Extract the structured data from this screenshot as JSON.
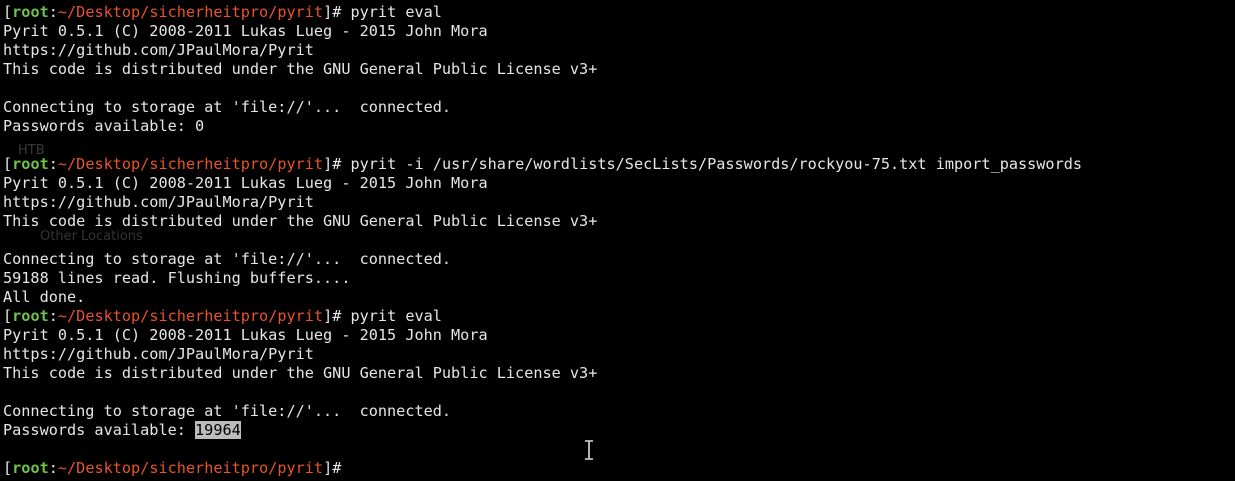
{
  "colors": {
    "background": "#000000",
    "text": "#e6e6e6",
    "user": "#6ec24a",
    "path": "#e8532a",
    "selection": "#bdbdbd"
  },
  "prompt": {
    "open": "[",
    "user": "root",
    "colon": ":",
    "path": "~/Desktop/sicherheitpro/pyrit",
    "close": "]#"
  },
  "ghost": {
    "text1": "HTB",
    "text2": "Other Locations"
  },
  "blocks": [
    {
      "command": " pyrit eval",
      "lines": [
        "Pyrit 0.5.1 (C) 2008-2011 Lukas Lueg - 2015 John Mora",
        "https://github.com/JPaulMora/Pyrit",
        "This code is distributed under the GNU General Public License v3+",
        "",
        "Connecting to storage at 'file://'...  connected.",
        "Passwords available: 0",
        ""
      ]
    },
    {
      "command": " pyrit -i /usr/share/wordlists/SecLists/Passwords/rockyou-75.txt import_passwords",
      "lines": [
        "Pyrit 0.5.1 (C) 2008-2011 Lukas Lueg - 2015 John Mora",
        "https://github.com/JPaulMora/Pyrit",
        "This code is distributed under the GNU General Public License v3+",
        "",
        "Connecting to storage at 'file://'...  connected.",
        "59188 lines read. Flushing buffers....",
        "All done."
      ]
    },
    {
      "command": " pyrit eval",
      "lines": [
        "Pyrit 0.5.1 (C) 2008-2011 Lukas Lueg - 2015 John Mora",
        "https://github.com/JPaulMora/Pyrit",
        "This code is distributed under the GNU General Public License v3+",
        "",
        "Connecting to storage at 'file://'...  connected."
      ],
      "final_label": "Passwords available: ",
      "final_value": "19964"
    }
  ]
}
